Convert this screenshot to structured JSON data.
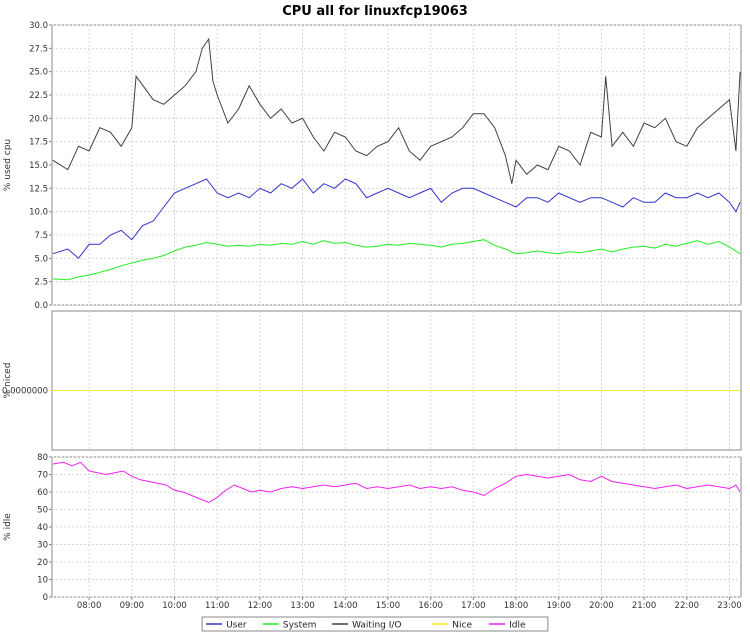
{
  "chart_data": {
    "title": "CPU all for linuxfcp19063",
    "type": "line",
    "x_ticks": [
      "08:00",
      "09:00",
      "10:00",
      "11:00",
      "12:00",
      "13:00",
      "14:00",
      "15:00",
      "16:00",
      "17:00",
      "18:00",
      "19:00",
      "20:00",
      "21:00",
      "22:00",
      "23:00"
    ],
    "x_tick_hours": [
      8,
      9,
      10,
      11,
      12,
      13,
      14,
      15,
      16,
      17,
      18,
      19,
      20,
      21,
      22,
      23
    ],
    "x_range": [
      7.13,
      23.27
    ],
    "panels": [
      {
        "ylabel": "% used cpu",
        "ylim": [
          0,
          30
        ],
        "y_ticks": [
          "0.0",
          "2.5",
          "5.0",
          "7.5",
          "10.0",
          "12.5",
          "15.0",
          "17.5",
          "20.0",
          "22.5",
          "25.0",
          "27.5",
          "30.0"
        ],
        "y_tick_values": [
          0,
          2.5,
          5,
          7.5,
          10,
          12.5,
          15,
          17.5,
          20,
          22.5,
          25,
          27.5,
          30
        ],
        "series": [
          {
            "name": "Waiting I/O",
            "color": "#404040",
            "x": [
              7.15,
              7.5,
              7.75,
              8.0,
              8.25,
              8.5,
              8.75,
              9.0,
              9.1,
              9.5,
              9.75,
              10.0,
              10.25,
              10.5,
              10.65,
              10.8,
              10.9,
              11.0,
              11.25,
              11.5,
              11.75,
              12.0,
              12.25,
              12.5,
              12.75,
              13.0,
              13.25,
              13.5,
              13.75,
              14.0,
              14.25,
              14.5,
              14.75,
              15.0,
              15.25,
              15.5,
              15.75,
              16.0,
              16.25,
              16.5,
              16.75,
              17.0,
              17.25,
              17.5,
              17.75,
              17.9,
              18.0,
              18.25,
              18.5,
              18.75,
              19.0,
              19.25,
              19.5,
              19.75,
              20.0,
              20.1,
              20.25,
              20.5,
              20.75,
              21.0,
              21.25,
              21.5,
              21.75,
              22.0,
              22.25,
              22.5,
              22.75,
              23.0,
              23.15,
              23.25
            ],
            "y": [
              15.5,
              14.5,
              17.0,
              16.5,
              19.0,
              18.5,
              17.0,
              19.0,
              24.5,
              22.0,
              21.5,
              22.5,
              23.5,
              25.0,
              27.5,
              28.5,
              24.0,
              22.5,
              19.5,
              21.0,
              23.5,
              21.5,
              20.0,
              21.0,
              19.5,
              20.0,
              18.0,
              16.5,
              18.5,
              18.0,
              16.5,
              16.0,
              17.0,
              17.5,
              19.0,
              16.5,
              15.5,
              17.0,
              17.5,
              18.0,
              19.0,
              20.5,
              20.5,
              19.0,
              16.0,
              13.0,
              15.5,
              14.0,
              15.0,
              14.5,
              17.0,
              16.5,
              15.0,
              18.5,
              18.0,
              24.5,
              17.0,
              18.5,
              17.0,
              19.5,
              19.0,
              20.0,
              17.5,
              17.0,
              19.0,
              20.0,
              21.0,
              22.0,
              16.5,
              25.0
            ]
          },
          {
            "name": "User",
            "color": "#3333cc",
            "x": [
              7.15,
              7.5,
              7.75,
              8.0,
              8.25,
              8.5,
              8.75,
              9.0,
              9.25,
              9.5,
              9.75,
              10.0,
              10.25,
              10.5,
              10.75,
              11.0,
              11.25,
              11.5,
              11.75,
              12.0,
              12.25,
              12.5,
              12.75,
              13.0,
              13.25,
              13.5,
              13.75,
              14.0,
              14.25,
              14.5,
              14.75,
              15.0,
              15.25,
              15.5,
              15.75,
              16.0,
              16.25,
              16.5,
              16.75,
              17.0,
              17.25,
              17.5,
              17.75,
              18.0,
              18.25,
              18.5,
              18.75,
              19.0,
              19.25,
              19.5,
              19.75,
              20.0,
              20.25,
              20.5,
              20.75,
              21.0,
              21.25,
              21.5,
              21.75,
              22.0,
              22.25,
              22.5,
              22.75,
              23.0,
              23.15,
              23.25
            ],
            "y": [
              5.5,
              6.0,
              5.0,
              6.5,
              6.5,
              7.5,
              8.0,
              7.0,
              8.5,
              9.0,
              10.5,
              12.0,
              12.5,
              13.0,
              13.5,
              12.0,
              11.5,
              12.0,
              11.5,
              12.5,
              12.0,
              13.0,
              12.5,
              13.5,
              12.0,
              13.0,
              12.5,
              13.5,
              13.0,
              11.5,
              12.0,
              12.5,
              12.0,
              11.5,
              12.0,
              12.5,
              11.0,
              12.0,
              12.5,
              12.5,
              12.0,
              11.5,
              11.0,
              10.5,
              11.5,
              11.5,
              11.0,
              12.0,
              11.5,
              11.0,
              11.5,
              11.5,
              11.0,
              10.5,
              11.5,
              11.0,
              11.0,
              12.0,
              11.5,
              11.5,
              12.0,
              11.5,
              12.0,
              11.0,
              10.0,
              11.0
            ]
          },
          {
            "name": "System",
            "color": "#22ee22",
            "x": [
              7.15,
              7.5,
              7.75,
              8.0,
              8.25,
              8.5,
              8.75,
              9.0,
              9.25,
              9.5,
              9.75,
              10.0,
              10.25,
              10.5,
              10.75,
              11.0,
              11.25,
              11.5,
              11.75,
              12.0,
              12.25,
              12.5,
              12.75,
              13.0,
              13.25,
              13.5,
              13.75,
              14.0,
              14.25,
              14.5,
              14.75,
              15.0,
              15.25,
              15.5,
              15.75,
              16.0,
              16.25,
              16.5,
              16.75,
              17.0,
              17.25,
              17.5,
              17.75,
              18.0,
              18.25,
              18.5,
              18.75,
              19.0,
              19.25,
              19.5,
              19.75,
              20.0,
              20.25,
              20.5,
              20.75,
              21.0,
              21.25,
              21.5,
              21.75,
              22.0,
              22.25,
              22.5,
              22.75,
              23.0,
              23.25
            ],
            "y": [
              2.8,
              2.7,
              3.0,
              3.2,
              3.5,
              3.8,
              4.2,
              4.5,
              4.8,
              5.0,
              5.3,
              5.8,
              6.2,
              6.4,
              6.7,
              6.5,
              6.3,
              6.4,
              6.3,
              6.5,
              6.4,
              6.6,
              6.5,
              6.8,
              6.5,
              6.9,
              6.6,
              6.7,
              6.4,
              6.2,
              6.3,
              6.5,
              6.4,
              6.6,
              6.5,
              6.4,
              6.2,
              6.5,
              6.6,
              6.8,
              7.0,
              6.4,
              6.0,
              5.5,
              5.6,
              5.8,
              5.6,
              5.5,
              5.7,
              5.6,
              5.8,
              6.0,
              5.7,
              6.0,
              6.2,
              6.3,
              6.1,
              6.5,
              6.3,
              6.6,
              6.9,
              6.5,
              6.8,
              6.2,
              5.5
            ]
          }
        ]
      },
      {
        "ylabel": "% niced",
        "y_ticks": [
          "0.0000000"
        ],
        "series": [
          {
            "name": "Nice",
            "color": "#eeee22",
            "x": [
              7.13,
              23.27
            ],
            "y": [
              0,
              0
            ]
          }
        ]
      },
      {
        "ylabel": "% idle",
        "ylim": [
          0,
          80
        ],
        "y_ticks": [
          "0",
          "10",
          "20",
          "30",
          "40",
          "50",
          "60",
          "70",
          "80"
        ],
        "y_tick_values": [
          0,
          10,
          20,
          30,
          40,
          50,
          60,
          70,
          80
        ],
        "series": [
          {
            "name": "Idle",
            "color": "#ee22ee",
            "x": [
              7.15,
              7.4,
              7.6,
              7.8,
              8.0,
              8.2,
              8.4,
              8.6,
              8.8,
              9.0,
              9.2,
              9.4,
              9.6,
              9.8,
              10.0,
              10.2,
              10.4,
              10.6,
              10.8,
              11.0,
              11.2,
              11.4,
              11.6,
              11.8,
              12.0,
              12.25,
              12.5,
              12.75,
              13.0,
              13.25,
              13.5,
              13.75,
              14.0,
              14.25,
              14.5,
              14.75,
              15.0,
              15.25,
              15.5,
              15.75,
              16.0,
              16.25,
              16.5,
              16.75,
              17.0,
              17.25,
              17.5,
              17.75,
              18.0,
              18.25,
              18.5,
              18.75,
              19.0,
              19.25,
              19.5,
              19.75,
              20.0,
              20.25,
              20.5,
              20.75,
              21.0,
              21.25,
              21.5,
              21.75,
              22.0,
              22.25,
              22.5,
              22.75,
              23.0,
              23.15,
              23.25
            ],
            "y": [
              76,
              77,
              75,
              77,
              72,
              71,
              70,
              71,
              72,
              69,
              67,
              66,
              65,
              64,
              61,
              60,
              58,
              56,
              54,
              57,
              61,
              64,
              62,
              60,
              61,
              60,
              62,
              63,
              62,
              63,
              64,
              63,
              64,
              65,
              62,
              63,
              62,
              63,
              64,
              62,
              63,
              62,
              63,
              61,
              60,
              58,
              62,
              65,
              69,
              70,
              69,
              68,
              69,
              70,
              67,
              66,
              69,
              66,
              65,
              64,
              63,
              62,
              63,
              64,
              62,
              63,
              64,
              63,
              62,
              64,
              60
            ]
          }
        ]
      }
    ],
    "legend": {
      "placement": "bottom",
      "entries": [
        {
          "name": "User",
          "color": "#3333cc"
        },
        {
          "name": "System",
          "color": "#22ee22"
        },
        {
          "name": "Waiting I/O",
          "color": "#404040"
        },
        {
          "name": "Nice",
          "color": "#eeee22"
        },
        {
          "name": "Idle",
          "color": "#ee22ee"
        }
      ]
    },
    "grid": true
  }
}
